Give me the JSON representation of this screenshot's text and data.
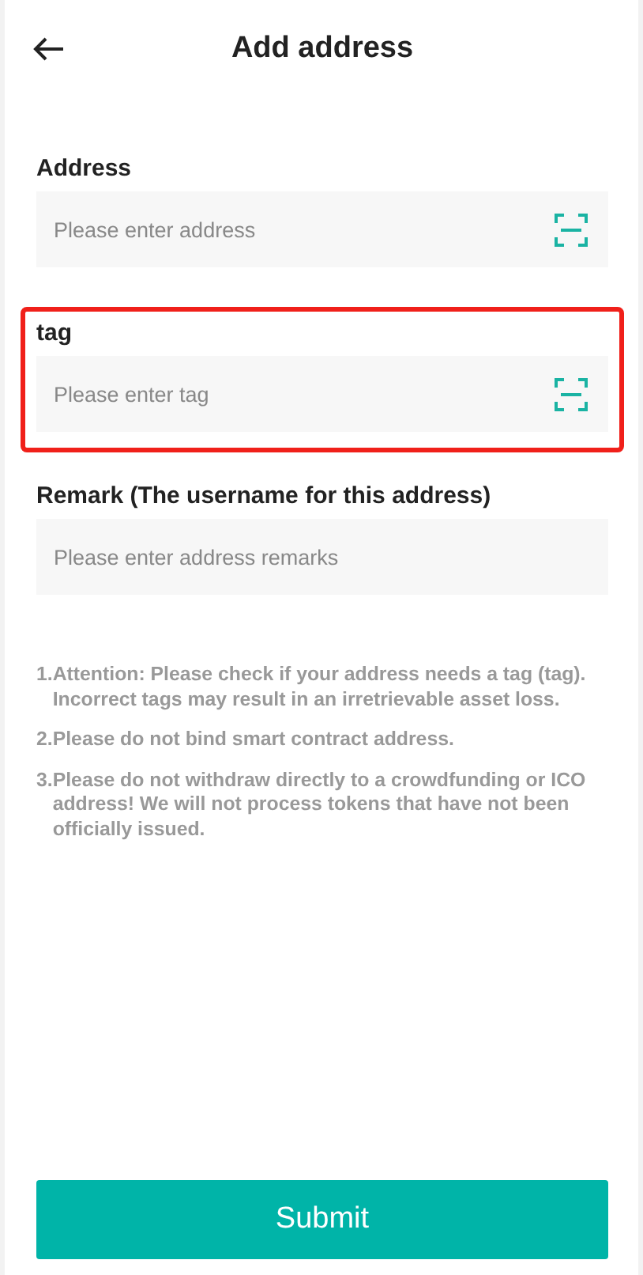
{
  "header": {
    "title": "Add address"
  },
  "fields": [
    {
      "label": "Address",
      "placeholder": "Please enter address",
      "scan": true,
      "highlighted": false
    },
    {
      "label": "tag",
      "placeholder": "Please enter tag",
      "scan": true,
      "highlighted": true
    },
    {
      "label": "Remark (The username for this address)",
      "placeholder": "Please enter address remarks",
      "scan": false,
      "highlighted": false
    }
  ],
  "notes": [
    {
      "number": "1.",
      "text": "Attention: Please check if your address needs a tag (tag). Incorrect tags may result in an irretrievable asset loss."
    },
    {
      "number": "2.",
      "text": "Please do not bind smart contract address."
    },
    {
      "number": "3.",
      "text": "Please do not withdraw directly to a crowdfunding or ICO address! We will not process tokens that have not been officially issued."
    }
  ],
  "submit_button": "Submit"
}
